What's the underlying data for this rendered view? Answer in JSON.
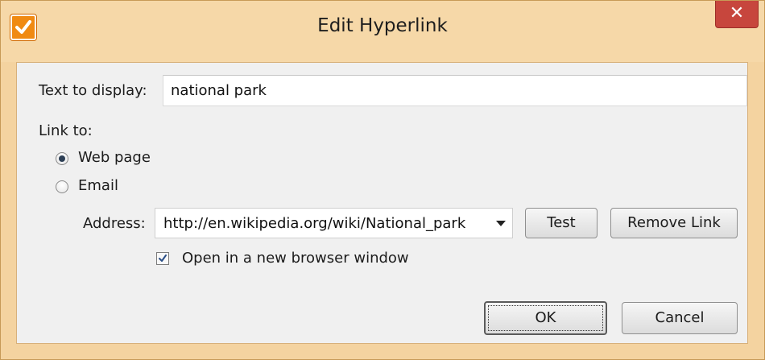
{
  "window": {
    "title": "Edit Hyperlink",
    "close_label": "✕"
  },
  "icons": {
    "app": "checkmark-app-icon",
    "close": "close-icon",
    "dropdown": "chevron-down-icon",
    "check": "checkmark-icon"
  },
  "colors": {
    "titlebar": "#f6d8a8",
    "close_button": "#c7463d",
    "app_icon": "#f08a12",
    "client": "#f0f0f0"
  },
  "form": {
    "text_label": "Text to display:",
    "text_value": "national park",
    "link_to_label": "Link to:",
    "options": [
      {
        "label": "Web page",
        "checked": true
      },
      {
        "label": "Email",
        "checked": false
      }
    ],
    "address_label": "Address:",
    "address_value": "http://en.wikipedia.org/wiki/National_park",
    "test_button": "Test",
    "remove_button": "Remove Link",
    "new_window_label": "Open in a new browser window",
    "new_window_checked": true
  },
  "buttons": {
    "ok": "OK",
    "cancel": "Cancel"
  }
}
